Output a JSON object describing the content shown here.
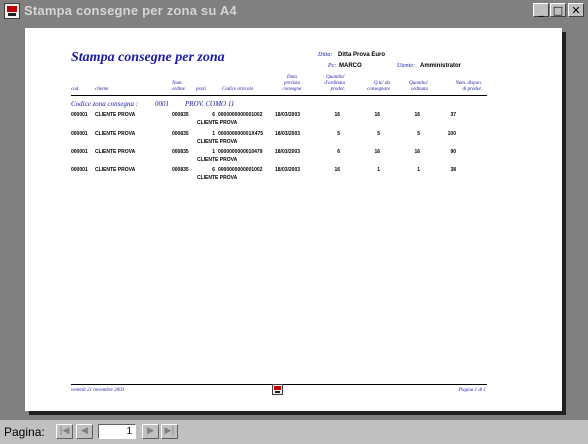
{
  "window": {
    "title": "Stampa consegne per zona su A4",
    "minimize_label": "_",
    "maximize_label": "□",
    "close_label": "✕"
  },
  "report": {
    "title": "Stampa consegne per zona",
    "ditta_label": "Ditta:",
    "ditta_value": "Ditta Prova Euro",
    "pc_label": "Pc:",
    "pc_value": "MARCO",
    "utente_label": "Utente:",
    "utente_value": "Amministrator",
    "headers": {
      "cod": "cod.",
      "cliente": "cliente",
      "num_ordine": "Num.\nordine",
      "pezzi": "pezzi",
      "codice_articolo": "Codice articolo",
      "data_prevista": "Data\nprevista\nconsegna",
      "quantita_ord": "Quantita'\nd'ordinata\nprodot.",
      "qta_consegnare": "Q.ta' da\nconsegnare",
      "quantita_ordinata": "Quantita'\nordinata",
      "num_disponibili": "Num. dispon.\ndi prodot."
    },
    "group": {
      "label": "Codice zona consegna :",
      "code": "0001",
      "name": "PROV. COMO 11"
    },
    "rows": [
      {
        "cod": "000001",
        "cliente": "CLIENTE PROVA",
        "ordine": "000835",
        "pezzi": "6",
        "articolo": "0000000000001002",
        "data": "18/03/2003",
        "q1": "16",
        "q2": "16",
        "q3": "16",
        "q4": "37",
        "desc": "CLIENTE PROVA"
      },
      {
        "cod": "000001",
        "cliente": "CLIENTE PROVA",
        "ordine": "000835",
        "pezzi": "1",
        "articolo": "000000000001X475",
        "data": "18/03/2003",
        "q1": "5",
        "q2": "5",
        "q3": "5",
        "q4": "100",
        "desc": "CLIENTE PROVA"
      },
      {
        "cod": "000001",
        "cliente": "CLIENTE PROVA",
        "ordine": "000835",
        "pezzi": "1",
        "articolo": "0000000000010479",
        "data": "18/03/2003",
        "q1": "6",
        "q2": "16",
        "q3": "16",
        "q4": "90",
        "desc": "CLIENTE PROVA"
      },
      {
        "cod": "000001",
        "cliente": "CLIENTE PROVA",
        "ordine": "000835",
        "pezzi": "6",
        "articolo": "0000000000001002",
        "data": "18/03/2003",
        "q1": "16",
        "q2": "1",
        "q3": "1",
        "q4": "38",
        "desc": "CLIENTE PROVA"
      }
    ],
    "footer_date": "venerdì 21 novembre 2003",
    "footer_page": "Pagina 1 di 1"
  },
  "statusbar": {
    "page_label": "Pagina:",
    "page_value": "1",
    "first_glyph": "|◀",
    "prev_glyph": "◀",
    "next_glyph": "▶",
    "last_glyph": "▶|"
  }
}
